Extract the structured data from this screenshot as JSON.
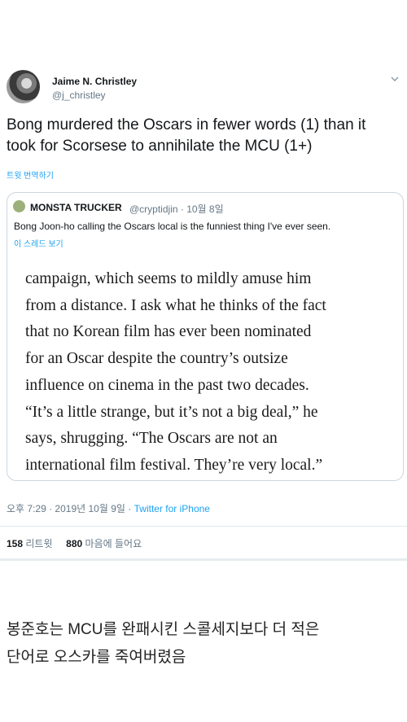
{
  "tweet": {
    "author_name": "Jaime N. Christley",
    "author_handle": "@j_christley",
    "text_lines": [
      "Bong murdered the Oscars in fewer words (1) than it",
      "took for Scorsese to annihilate the MCU (1+)"
    ],
    "translate_label": "트윗 번역하기",
    "timestamp": "오후 7:29 · 2019년 10월 9일 · ",
    "source": "Twitter for iPhone",
    "retweets_count": "158",
    "retweets_label": "리트윗",
    "likes_count": "880",
    "likes_label": "마음에 들어요"
  },
  "quote": {
    "author_name": "MONSTA TRUCKER",
    "meta": "@cryptidjin · 10월 8일",
    "text": "Bong Joon-ho calling the Oscars local is the funniest thing I've ever seen.",
    "thread_label": "이 스레드 보기",
    "image_lines": [
      "campaign, which seems to mildly amuse him",
      "from a distance. I ask what he thinks of the fact",
      "that no Korean film has ever been nominated",
      "for an Oscar despite the country’s outsize",
      "influence on cinema in the past two decades.",
      "“It’s a little strange, but it’s not a big deal,” he",
      "says, shrugging. “The Oscars are not an",
      "international film festival. They’re very local.”"
    ]
  },
  "caption_lines": [
    "봉준호는 MCU를 완패시킨 스콜세지보다 더 적은",
    "단어로 오스카를 죽여버렸음"
  ]
}
